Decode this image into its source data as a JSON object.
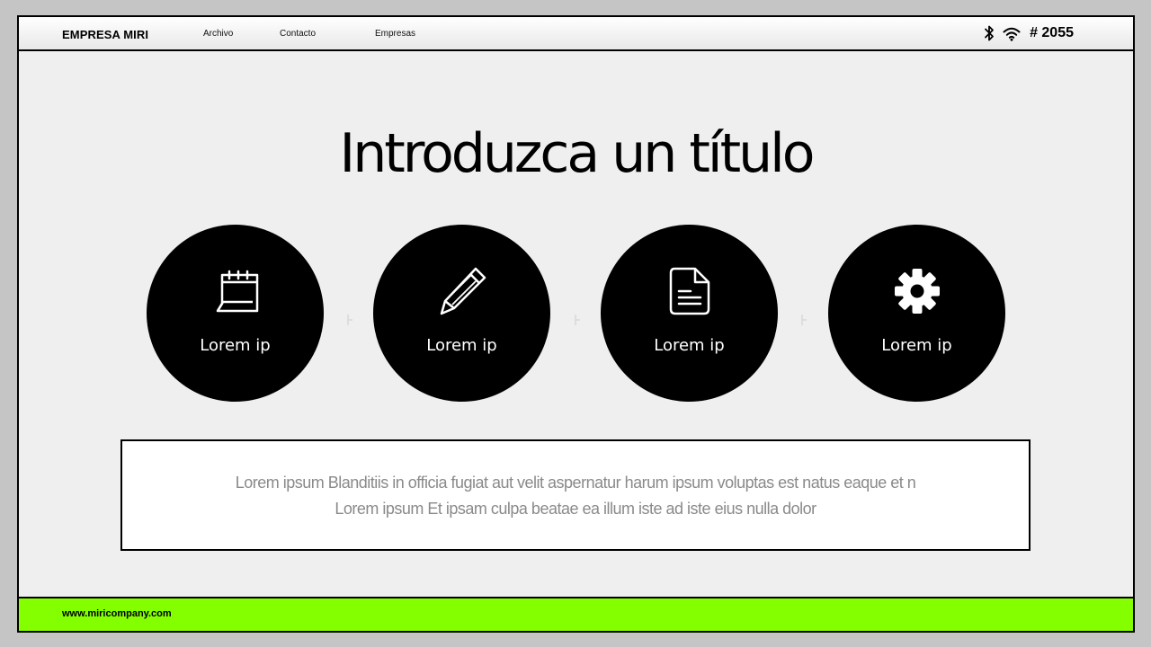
{
  "header": {
    "brand": "EMPRESA MIRI",
    "nav": [
      "Archivo",
      "Contacto",
      "Empresas"
    ],
    "counter": "# 2055",
    "icons": [
      "bluetooth-icon",
      "wifi-icon"
    ]
  },
  "main": {
    "title": "Introduzca un título",
    "cards": [
      {
        "icon": "calendar-icon",
        "label": "Lorem ip"
      },
      {
        "icon": "pencil-icon",
        "label": "Lorem ip"
      },
      {
        "icon": "document-icon",
        "label": "Lorem ip"
      },
      {
        "icon": "gear-icon",
        "label": "Lorem ip"
      }
    ],
    "body_lines": [
      "Lorem ipsum Blanditiis in officia fugiat aut velit aspernatur harum ipsum voluptas est natus eaque et n",
      "Lorem ipsum Et ipsam culpa beatae ea illum iste ad iste eius nulla dolor"
    ]
  },
  "footer": {
    "url": "www.miricompany.com"
  },
  "colors": {
    "footer_bg": "#84ff00",
    "page_bg": "#efefef",
    "circle_bg": "#000000",
    "body_text": "#8a8a8a"
  }
}
